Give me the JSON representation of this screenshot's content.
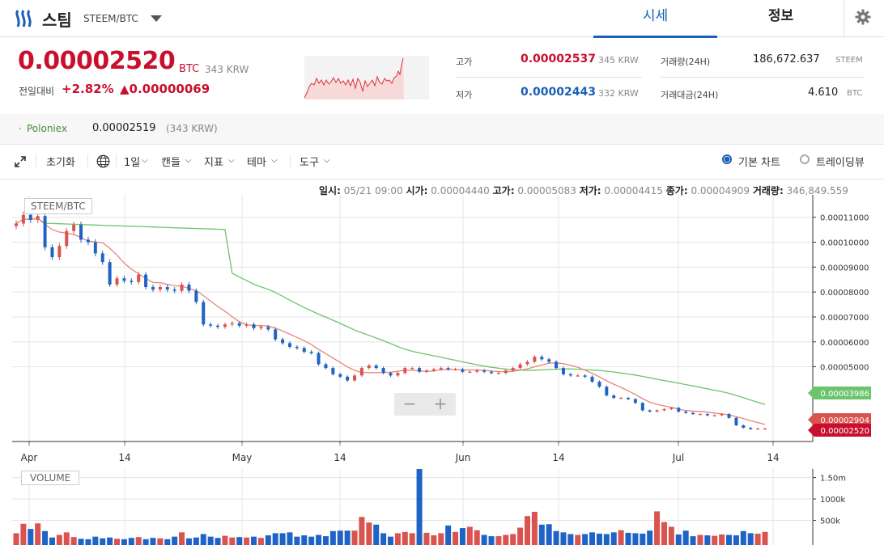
{
  "header": {
    "coin_name": "스팀",
    "pair": "STEEM/BTC",
    "tabs": [
      "시세",
      "정보"
    ],
    "settings_icon": "gear-icon"
  },
  "price": {
    "current": "0.00002520",
    "currency": "BTC",
    "krw": "343 KRW",
    "change_label": "전일대비",
    "change_pct": "+2.82%",
    "change_amount": "▲0.00000069"
  },
  "stats": {
    "high_label": "고가",
    "high": "0.00002537",
    "high_krw": "345 KRW",
    "low_label": "저가",
    "low": "0.00002443",
    "low_krw": "332 KRW",
    "volume_label": "거래량(24H)",
    "volume": "186,672.637",
    "volume_unit": "STEEM",
    "value_label": "거래대금(24H)",
    "value": "4.610",
    "value_unit": "BTC"
  },
  "exchange": {
    "name": "Poloniex",
    "price": "0.00002519",
    "krw": "(343 KRW)"
  },
  "toolbar": {
    "reset": "초기화",
    "period": "1일",
    "candle": "캔들",
    "indicator": "지표",
    "theme": "테마",
    "tools": "도구",
    "basic_chart": "기본 차트",
    "trading_view": "트레이딩뷰"
  },
  "ohlc": {
    "date_label": "일시:",
    "date": "05/21 09:00",
    "open_label": "시가:",
    "open": "0.00004440",
    "high_label": "고가:",
    "high": "0.00005083",
    "low_label": "저가:",
    "low": "0.00004415",
    "close_label": "종가:",
    "close": "0.00004909",
    "volume_label": "거래량:",
    "volume": "346,849.559"
  },
  "chart_legend": "STEEM/BTC",
  "volume_legend": "VOLUME",
  "zoom": {
    "minus": "−",
    "plus": "+"
  },
  "colors": {
    "up": "#d9534f",
    "down": "#1f63c6",
    "ma_short": "#e8857a",
    "ma_long": "#6cc46c",
    "accent": "#1a5fb4"
  },
  "chart_data": {
    "type": "candlestick",
    "x_ticks": [
      "Apr",
      "14",
      "May",
      "14",
      "Jun",
      "14",
      "Jul",
      "14"
    ],
    "y_ticks": [
      "0.00011000",
      "0.00010000",
      "0.00009000",
      "0.00008000",
      "0.00007000",
      "0.00006000",
      "0.00005000"
    ],
    "ylim": [
      2e-05,
      0.000119
    ],
    "price_tags": {
      "ma_long": "0.00003986",
      "ma_short": "0.00002904",
      "last": "0.00002520"
    },
    "volume_ticks": [
      "1.50m",
      "1000k",
      "500k"
    ],
    "volume_ylim": [
      0,
      1700000
    ],
    "closes": [
      0.0001075,
      0.000111,
      0.000109,
      0.0001105,
      9.8e-05,
      9.4e-05,
      9.85e-05,
      0.0001045,
      0.000107,
      0.000101,
      0.0001,
      9.55e-05,
      9.2e-05,
      8.3e-05,
      8.55e-05,
      8.45e-05,
      8.4e-05,
      8.7e-05,
      8.2e-05,
      8.1e-05,
      8.2e-05,
      8.1e-05,
      8.05e-05,
      8.3e-05,
      8.05e-05,
      7.6e-05,
      6.7e-05,
      6.65e-05,
      6.6e-05,
      6.7e-05,
      6.75e-05,
      6.65e-05,
      6.7e-05,
      6.55e-05,
      6.6e-05,
      6.5e-05,
      6.1e-05,
      5.95e-05,
      5.8e-05,
      5.75e-05,
      5.6e-05,
      5.55e-05,
      5.1e-05,
      4.95e-05,
      4.7e-05,
      4.6e-05,
      4.45e-05,
      4.65e-05,
      4.95e-05,
      5.05e-05,
      4.95e-05,
      4.75e-05,
      4.65e-05,
      4.75e-05,
      4.95e-05,
      4.95e-05,
      4.8e-05,
      4.85e-05,
      4.9e-05,
      4.95e-05,
      4.9e-05,
      4.9e-05,
      4.8e-05,
      4.8e-05,
      4.85e-05,
      4.8e-05,
      4.75e-05,
      4.75e-05,
      4.85e-05,
      4.95e-05,
      5.1e-05,
      5.2e-05,
      5.4e-05,
      5.3e-05,
      5.2e-05,
      4.95e-05,
      4.7e-05,
      4.65e-05,
      4.65e-05,
      4.6e-05,
      4.4e-05,
      4.2e-05,
      3.85e-05,
      3.75e-05,
      3.75e-05,
      3.7e-05,
      3.55e-05,
      3.25e-05,
      3.2e-05,
      3.25e-05,
      3.3e-05,
      3.35e-05,
      3.2e-05,
      3.15e-05,
      3.1e-05,
      3.1e-05,
      3.05e-05,
      3.05e-05,
      3.1e-05,
      2.95e-05,
      2.65e-05,
      2.55e-05,
      2.5e-05,
      2.52e-05,
      2.52e-05
    ],
    "volumes": [
      200000,
      420000,
      300000,
      430000,
      250000,
      100000,
      160000,
      220000,
      110000,
      70000,
      60000,
      120000,
      80000,
      100000,
      70000,
      60000,
      90000,
      110000,
      60000,
      90000,
      80000,
      60000,
      120000,
      220000,
      80000,
      100000,
      180000,
      120000,
      90000,
      140000,
      100000,
      110000,
      100000,
      120000,
      90000,
      150000,
      200000,
      200000,
      220000,
      120000,
      150000,
      120000,
      160000,
      130000,
      250000,
      260000,
      260000,
      260000,
      580000,
      450000,
      400000,
      200000,
      120000,
      200000,
      230000,
      200000,
      1700000,
      210000,
      150000,
      200000,
      380000,
      230000,
      320000,
      350000,
      270000,
      160000,
      130000,
      130000,
      160000,
      180000,
      330000,
      600000,
      700000,
      400000,
      410000,
      250000,
      220000,
      180000,
      160000,
      180000,
      220000,
      190000,
      180000,
      220000,
      270000,
      210000,
      200000,
      190000,
      260000,
      710000,
      460000,
      350000,
      170000,
      260000,
      130000,
      160000,
      150000,
      140000,
      170000,
      160000,
      150000,
      250000,
      200000,
      190000,
      230000
    ]
  }
}
